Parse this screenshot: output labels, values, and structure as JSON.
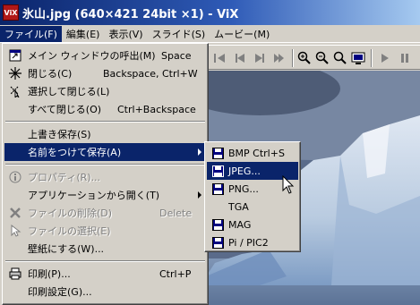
{
  "window": {
    "icon_text": "ViX",
    "title": "氷山.jpg (640×421 24bit ×1) - ViX"
  },
  "menubar": [
    {
      "label": "ファイル(F)",
      "active": true
    },
    {
      "label": "編集(E)"
    },
    {
      "label": "表示(V)"
    },
    {
      "label": "スライド(S)"
    },
    {
      "label": "ムービー(M)"
    }
  ],
  "file_menu": {
    "items": [
      {
        "label": "メイン ウィンドウの呼出(M)",
        "shortcut": "Space",
        "icon": "main-window-icon"
      },
      {
        "label": "閉じる(C)",
        "shortcut": "Backspace, Ctrl+W",
        "icon": "close-sparkle-icon"
      },
      {
        "label": "選択して閉じる(L)",
        "shortcut": "",
        "icon": "select-close-icon"
      },
      {
        "label": "すべて閉じる(O)",
        "shortcut": "Ctrl+Backspace"
      },
      {
        "label": "上書き保存(S)",
        "shortcut": ""
      },
      {
        "label": "名前をつけて保存(A)",
        "shortcut": "",
        "submenu": true,
        "highlighted": true
      },
      {
        "label": "プロパティ(R)...",
        "shortcut": "",
        "disabled": true,
        "icon": "info-icon"
      },
      {
        "label": "アプリケーションから開く(T)",
        "shortcut": "",
        "submenu": true
      },
      {
        "label": "ファイルの削除(D)",
        "shortcut": "Delete",
        "disabled": true,
        "icon": "delete-x-icon"
      },
      {
        "label": "ファイルの選択(E)",
        "shortcut": "",
        "disabled": true,
        "icon": "select-file-icon"
      },
      {
        "label": "壁紙にする(W)...",
        "shortcut": ""
      },
      {
        "label": "印刷(P)...",
        "shortcut": "Ctrl+P",
        "icon": "printer-icon"
      },
      {
        "label": "印刷設定(G)...",
        "shortcut": ""
      }
    ]
  },
  "save_as_submenu": {
    "items": [
      {
        "label": "BMP Ctrl+S",
        "icon": "save-icon"
      },
      {
        "label": "JPEG...",
        "icon": "save-icon",
        "highlighted": true
      },
      {
        "label": "PNG...",
        "icon": "save-icon"
      },
      {
        "label": "TGA"
      },
      {
        "label": "MAG",
        "icon": "save-icon"
      },
      {
        "label": "Pi / PIC2",
        "icon": "save-icon"
      }
    ]
  },
  "colors": {
    "title_gradient_start": "#0a246a",
    "menu_highlight": "#0a246a",
    "face": "#d4d0c8"
  }
}
